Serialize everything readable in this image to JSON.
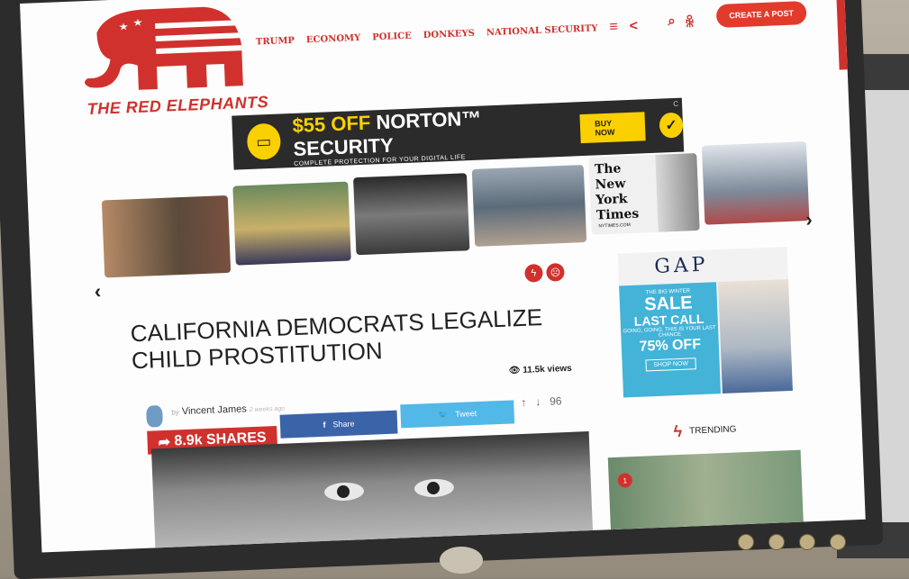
{
  "site": {
    "name": "THE RED ELEPHANTS",
    "accent": "#d0312d"
  },
  "nav": {
    "items": [
      "TRUMP",
      "ECONOMY",
      "POLICE",
      "DONKEYS",
      "NATIONAL SECURITY"
    ],
    "menu_icon": "hamburger-icon",
    "share_icon": "share-icon"
  },
  "header": {
    "search_icon": "search-icon",
    "user_icon": "user-icon",
    "create_post": "CREATE A POST"
  },
  "ad": {
    "price": "$55 OFF",
    "product": "NORTON™ SECURITY",
    "tagline": "COMPLETE PROTECTION FOR YOUR DIGITAL LIFE",
    "cta": "BUY NOW",
    "brand": "Norton",
    "corner": "C"
  },
  "thumbnails": {
    "nyt_text": "The New York Times",
    "nyt_sub": "NYTIMES.COM"
  },
  "article": {
    "title": "CALIFORNIA DEMOCRATS LEGALIZE CHILD PROSTITUTION",
    "views": "11.5k views",
    "by": "by",
    "author": "Vincent James",
    "ago": "2 weeks ago",
    "shares": "8.9k SHARES",
    "share_fb": "Share",
    "share_tw": "Tweet",
    "votes": "96"
  },
  "sidebar": {
    "gap_logo": "GAP",
    "gap_line1": "THE BIG WINTER",
    "gap_sale": "SALE",
    "gap_last": "LAST CALL",
    "gap_line2": "GOING, GOING. THIS IS YOUR LAST CHANCE",
    "gap_off": "75% OFF",
    "gap_shop": "SHOP NOW",
    "trending": "TRENDING",
    "trend_rank": "1"
  }
}
